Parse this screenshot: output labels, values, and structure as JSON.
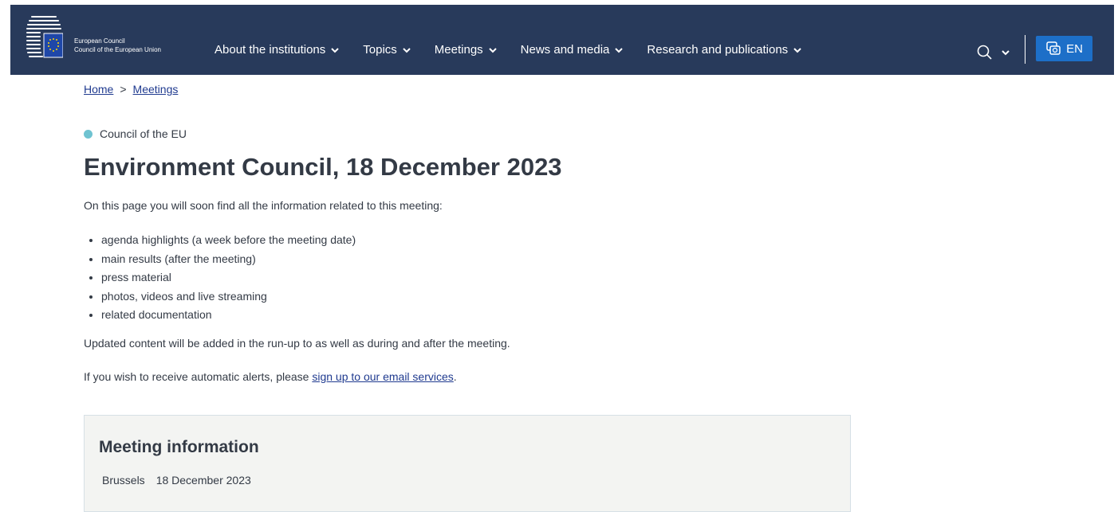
{
  "header": {
    "org_line1": "European Council",
    "org_line2": "Council of the European Union",
    "nav": [
      {
        "label": "About the institutions"
      },
      {
        "label": "Topics"
      },
      {
        "label": "Meetings"
      },
      {
        "label": "News and media"
      },
      {
        "label": "Research and publications"
      }
    ],
    "language": "EN",
    "icons": [
      "search-icon",
      "chevron-down-icon",
      "language-icon"
    ],
    "background_color": "#283a5b",
    "accent_color": "#1d6fc8"
  },
  "breadcrumb": {
    "home": "Home",
    "separator": ">",
    "current": "Meetings"
  },
  "page": {
    "tag": "Council of the EU",
    "tag_color": "#6fc3d1",
    "title": "Environment Council, 18 December 2023",
    "intro": "On this page you will soon find all the information related to this meeting:",
    "items": [
      "agenda highlights (a week before the meeting date)",
      "main results (after the meeting)",
      "press material",
      "photos, videos and live streaming",
      "related documentation"
    ],
    "update_text": "Updated content will be added in the run-up to as well as during and after the meeting.",
    "alerts_prefix": "If you wish to receive automatic alerts, please ",
    "alerts_link": "sign up to our email services",
    "alerts_suffix": "."
  },
  "meeting_info": {
    "heading": "Meeting information",
    "location": "Brussels",
    "date": "18 December 2023"
  }
}
